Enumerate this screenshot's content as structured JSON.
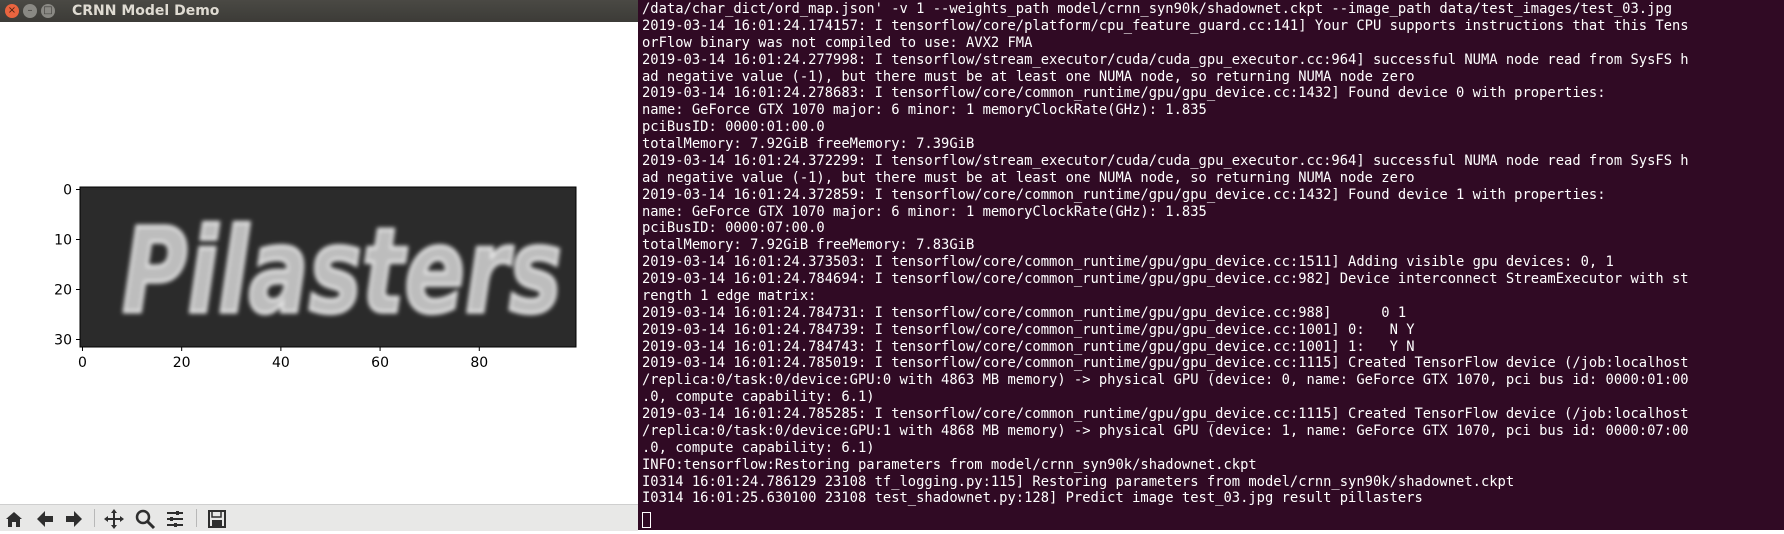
{
  "window": {
    "title": "CRNN Model Demo",
    "close_glyph": "×",
    "min_glyph": "–",
    "max_glyph": "□"
  },
  "figure": {
    "image_text": "Pilasters",
    "xticks": [
      "0",
      "20",
      "40",
      "60",
      "80"
    ],
    "yticks": [
      "0",
      "10",
      "20",
      "30"
    ],
    "image_shape": [
      32,
      100
    ]
  },
  "toolbar": {
    "buttons": [
      "home-icon",
      "back-icon",
      "forward-icon",
      "pan-icon",
      "zoom-icon",
      "configure-subplots-icon",
      "save-icon"
    ]
  },
  "terminal": {
    "lines": [
      "/data/char_dict/ord_map.json' -v 1 --weights_path model/crnn_syn90k/shadownet.ckpt --image_path data/test_images/test_03.jpg",
      "2019-03-14 16:01:24.174157: I tensorflow/core/platform/cpu_feature_guard.cc:141] Your CPU supports instructions that this Tens",
      "orFlow binary was not compiled to use: AVX2 FMA",
      "2019-03-14 16:01:24.277998: I tensorflow/stream_executor/cuda/cuda_gpu_executor.cc:964] successful NUMA node read from SysFS h",
      "ad negative value (-1), but there must be at least one NUMA node, so returning NUMA node zero",
      "2019-03-14 16:01:24.278683: I tensorflow/core/common_runtime/gpu/gpu_device.cc:1432] Found device 0 with properties:",
      "name: GeForce GTX 1070 major: 6 minor: 1 memoryClockRate(GHz): 1.835",
      "pciBusID: 0000:01:00.0",
      "totalMemory: 7.92GiB freeMemory: 7.39GiB",
      "2019-03-14 16:01:24.372299: I tensorflow/stream_executor/cuda/cuda_gpu_executor.cc:964] successful NUMA node read from SysFS h",
      "ad negative value (-1), but there must be at least one NUMA node, so returning NUMA node zero",
      "2019-03-14 16:01:24.372859: I tensorflow/core/common_runtime/gpu/gpu_device.cc:1432] Found device 1 with properties:",
      "name: GeForce GTX 1070 major: 6 minor: 1 memoryClockRate(GHz): 1.835",
      "pciBusID: 0000:07:00.0",
      "totalMemory: 7.92GiB freeMemory: 7.83GiB",
      "2019-03-14 16:01:24.373503: I tensorflow/core/common_runtime/gpu/gpu_device.cc:1511] Adding visible gpu devices: 0, 1",
      "2019-03-14 16:01:24.784694: I tensorflow/core/common_runtime/gpu/gpu_device.cc:982] Device interconnect StreamExecutor with st",
      "rength 1 edge matrix:",
      "2019-03-14 16:01:24.784731: I tensorflow/core/common_runtime/gpu/gpu_device.cc:988]      0 1",
      "2019-03-14 16:01:24.784739: I tensorflow/core/common_runtime/gpu/gpu_device.cc:1001] 0:   N Y",
      "2019-03-14 16:01:24.784743: I tensorflow/core/common_runtime/gpu/gpu_device.cc:1001] 1:   Y N",
      "2019-03-14 16:01:24.785019: I tensorflow/core/common_runtime/gpu/gpu_device.cc:1115] Created TensorFlow device (/job:localhost",
      "/replica:0/task:0/device:GPU:0 with 4863 MB memory) -> physical GPU (device: 0, name: GeForce GTX 1070, pci bus id: 0000:01:00",
      ".0, compute capability: 6.1)",
      "2019-03-14 16:01:24.785285: I tensorflow/core/common_runtime/gpu/gpu_device.cc:1115] Created TensorFlow device (/job:localhost",
      "/replica:0/task:0/device:GPU:1 with 4868 MB memory) -> physical GPU (device: 1, name: GeForce GTX 1070, pci bus id: 0000:07:00",
      ".0, compute capability: 6.1)",
      "INFO:tensorflow:Restoring parameters from model/crnn_syn90k/shadownet.ckpt",
      "I0314 16:01:24.786129 23108 tf_logging.py:115] Restoring parameters from model/crnn_syn90k/shadownet.ckpt",
      "I0314 16:01:25.630100 23108 test_shadownet.py:128] Predict image test_03.jpg result pillasters"
    ]
  },
  "colors": {
    "terminal_bg": "#300a24",
    "terminal_fg": "#ffffff",
    "titlebar_bg": "#3c3b37",
    "close_button": "#e9643f"
  }
}
